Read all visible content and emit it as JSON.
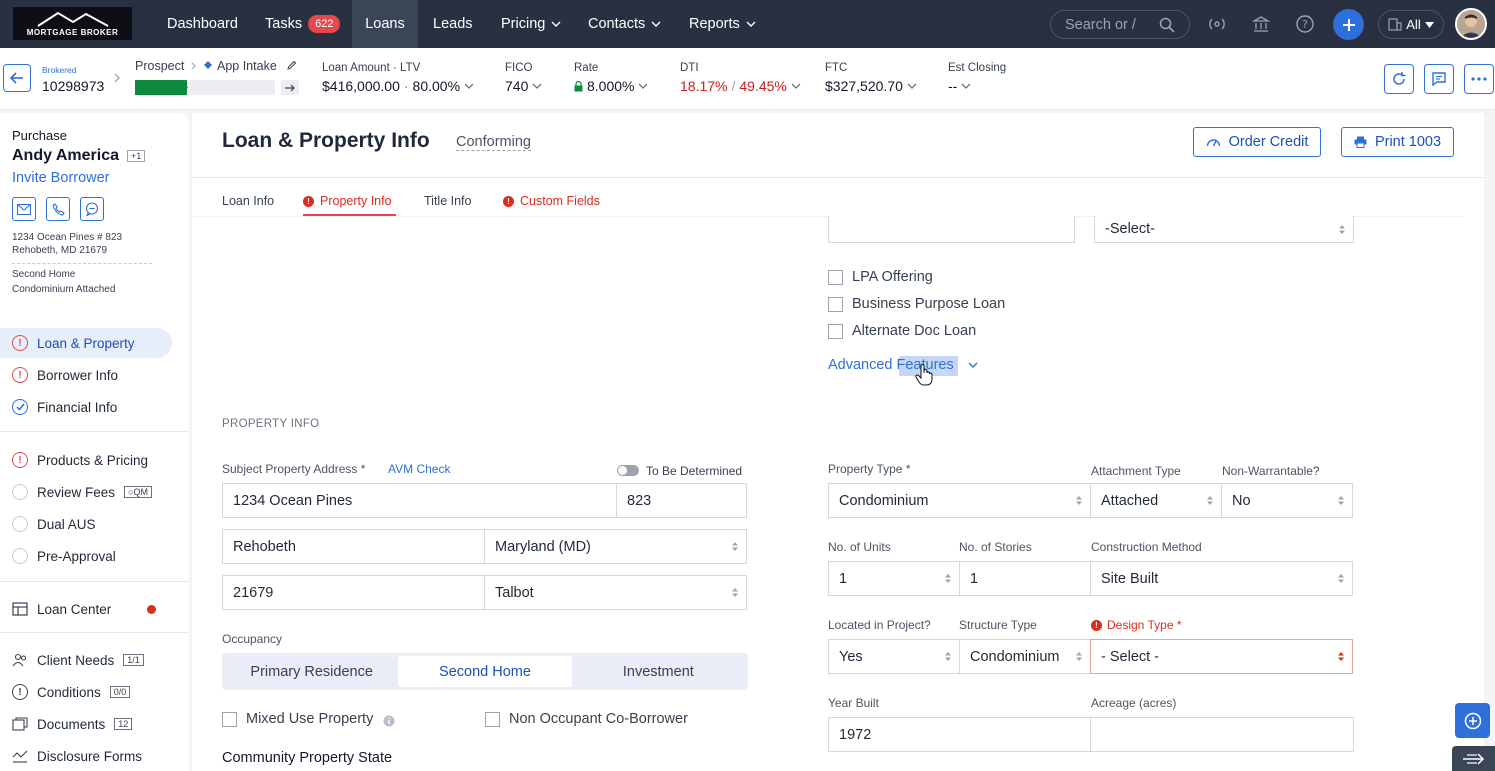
{
  "brand": {
    "logo_text": "MORTGAGE BROKER"
  },
  "nav": {
    "items": [
      {
        "label": "Dashboard"
      },
      {
        "label": "Tasks",
        "badge": "622"
      },
      {
        "label": "Loans"
      },
      {
        "label": "Leads"
      },
      {
        "label": "Pricing"
      },
      {
        "label": "Contacts"
      },
      {
        "label": "Reports"
      }
    ],
    "search_placeholder": "Search or /",
    "scope_label": "All"
  },
  "summary": {
    "channel": "Brokered",
    "loan_number": "10298973",
    "stage": "Prospect",
    "milestone": "App Intake",
    "loan_amount_label": "Loan Amount · LTV",
    "loan_amount": "$416,000.00",
    "ltv": "80.00%",
    "fico_label": "FICO",
    "fico": "740",
    "rate_label": "Rate",
    "rate": "8.000%",
    "dti_label": "DTI",
    "dti_front": "18.17%",
    "dti_back": "49.45%",
    "ftc_label": "FTC",
    "ftc": "$327,520.70",
    "closing_label": "Est Closing",
    "closing": "--"
  },
  "sidebar": {
    "purpose": "Purchase",
    "borrower": "Andy America",
    "extra_borrowers": "+1",
    "invite": "Invite Borrower",
    "address_line1": "1234 Ocean Pines # 823",
    "address_line2": "Rehobeth, MD 21679",
    "occupancy": "Second Home",
    "property": "Condominium Attached",
    "items": [
      {
        "label": "Loan & Property"
      },
      {
        "label": "Borrower Info"
      },
      {
        "label": "Financial Info"
      },
      {
        "label": "Products & Pricing"
      },
      {
        "label": "Review Fees",
        "tag": "QM"
      },
      {
        "label": "Dual AUS"
      },
      {
        "label": "Pre-Approval"
      },
      {
        "label": "Loan Center"
      },
      {
        "label": "Client Needs",
        "tag": "1/1"
      },
      {
        "label": "Conditions",
        "tag": "0/0"
      },
      {
        "label": "Documents",
        "tag": "12"
      },
      {
        "label": "Disclosure Forms"
      }
    ]
  },
  "page": {
    "title": "Loan & Property Info",
    "subtitle": "Conforming",
    "order_credit": "Order Credit",
    "print": "Print 1003",
    "tabs": [
      {
        "label": "Loan Info"
      },
      {
        "label": "Property Info"
      },
      {
        "label": "Title Info"
      },
      {
        "label": "Custom Fields"
      }
    ]
  },
  "loan_section": {
    "top_select": "-Select-",
    "checkboxes": [
      "LPA Offering",
      "Business Purpose Loan",
      "Alternate Doc Loan"
    ],
    "advanced_features": "Advanced Features"
  },
  "property": {
    "section_title": "PROPERTY INFO",
    "address_label": "Subject Property Address *",
    "avm_check": "AVM Check",
    "tbd_label": "To Be Determined",
    "street": "1234 Ocean Pines",
    "unit": "823",
    "city": "Rehobeth",
    "state": "Maryland (MD)",
    "zip": "21679",
    "county": "Talbot",
    "occupancy_label": "Occupancy",
    "occupancy_options": [
      "Primary Residence",
      "Second Home",
      "Investment"
    ],
    "mixed_use": "Mixed Use Property",
    "non_occupant": "Non Occupant Co-Borrower",
    "community_state": "Community Property State",
    "property_type_label": "Property Type *",
    "property_type": "Condominium",
    "attachment_label": "Attachment Type",
    "attachment": "Attached",
    "non_warrantable_label": "Non-Warrantable?",
    "non_warrantable": "No",
    "units_label": "No. of Units",
    "units": "1",
    "stories_label": "No. of Stories",
    "stories": "1",
    "construction_label": "Construction Method",
    "construction": "Site Built",
    "in_project_label": "Located in Project?",
    "in_project": "Yes",
    "structure_label": "Structure Type",
    "structure": "Condominium",
    "design_label": "Design Type *",
    "design": "- Select -",
    "year_built_label": "Year Built",
    "year_built": "1972",
    "acreage_label": "Acreage (acres)",
    "acreage": ""
  },
  "colors": {
    "nav_bg": "#283042",
    "accent": "#2f6fdb",
    "error": "#d92d20"
  }
}
